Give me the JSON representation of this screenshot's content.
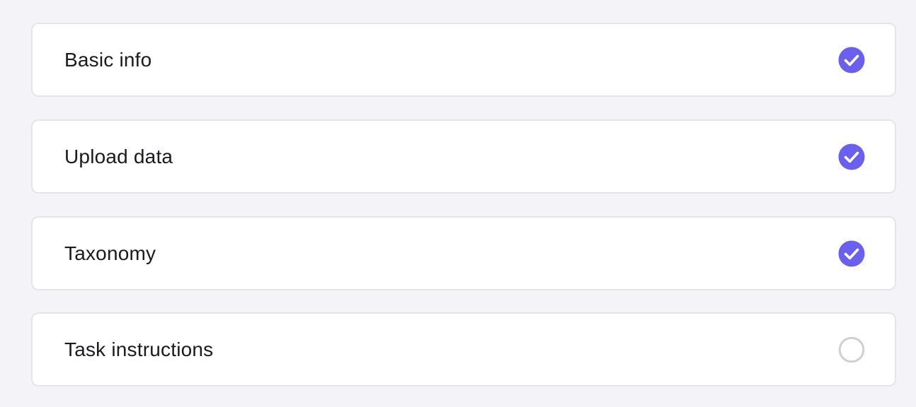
{
  "accent_color": "#6b5ff0",
  "pending_color": "#cfcfd4",
  "steps": [
    {
      "label": "Basic info",
      "completed": true,
      "icon": "check-circle-icon"
    },
    {
      "label": "Upload data",
      "completed": true,
      "icon": "check-circle-icon"
    },
    {
      "label": "Taxonomy",
      "completed": true,
      "icon": "check-circle-icon"
    },
    {
      "label": "Task instructions",
      "completed": false,
      "icon": "empty-circle-icon"
    }
  ]
}
